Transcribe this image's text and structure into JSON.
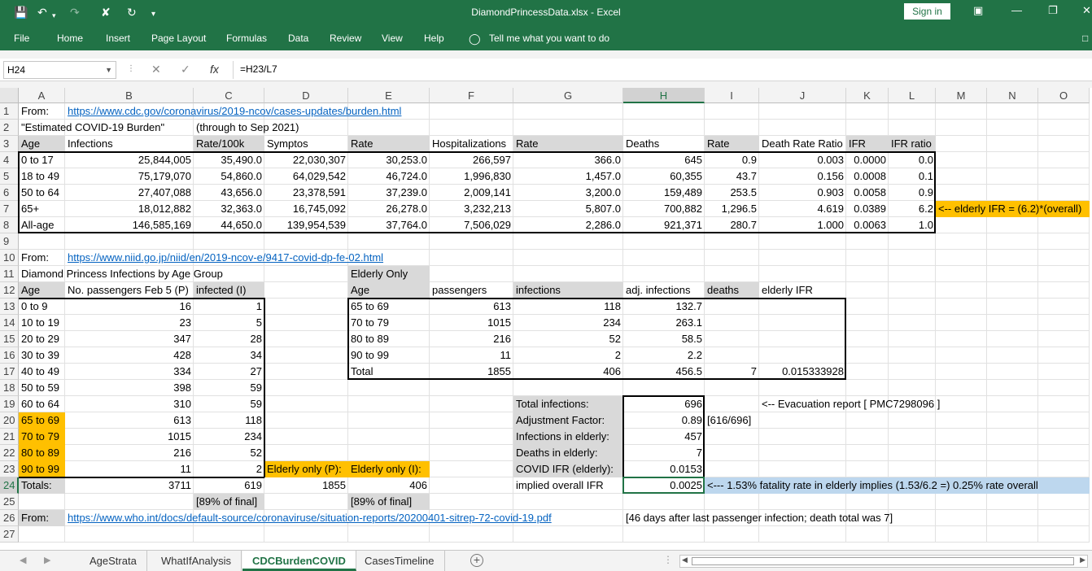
{
  "window": {
    "title": "DiamondPrincessData.xlsx  -  Excel",
    "signin": "Sign in",
    "icons": [
      "save-icon",
      "undo-icon",
      "redo-icon",
      "clear-format-icon",
      "refresh-icon",
      "customize-icon",
      "ribbon-display-icon",
      "minimize-icon",
      "restore-icon",
      "close-icon"
    ]
  },
  "ribbon": {
    "tabs": [
      "File",
      "Home",
      "Insert",
      "Page Layout",
      "Formulas",
      "Data",
      "Review",
      "View",
      "Help"
    ],
    "tell_me": "Tell me what you want to do"
  },
  "formula_bar": {
    "name_box": "H24",
    "fx": "fx",
    "formula": "=H23/L7"
  },
  "columns": [
    "A",
    "B",
    "C",
    "D",
    "E",
    "F",
    "G",
    "H",
    "I",
    "J",
    "K",
    "L",
    "M",
    "N",
    "O"
  ],
  "rows": [
    "1",
    "2",
    "3",
    "4",
    "5",
    "6",
    "7",
    "8",
    "9",
    "10",
    "11",
    "12",
    "13",
    "14",
    "15",
    "16",
    "17",
    "18",
    "19",
    "20",
    "21",
    "22",
    "23",
    "24",
    "25",
    "26",
    "27"
  ],
  "cells": {
    "A1": "From:",
    "B1": "https://www.cdc.gov/coronavirus/2019-ncov/cases-updates/burden.html",
    "A2": "\"Estimated COVID-19 Burden\"",
    "C2": "(through to Sep 2021)",
    "A3": "Age",
    "B3": "Infections",
    "C3": "Rate/100k",
    "D3": "Symptos",
    "E3": "Rate",
    "F3": "Hospitalizations",
    "G3": "Rate",
    "H3": "Deaths",
    "I3": "Rate",
    "J3": "Death Rate Ratio",
    "K3": "IFR",
    "L3": "IFR ratio",
    "A4": "0 to 17",
    "B4": "25,844,005",
    "C4": "35,490.0",
    "D4": "22,030,307",
    "E4": "30,253.0",
    "F4": "266,597",
    "G4": "366.0",
    "H4": "645",
    "I4": "0.9",
    "J4": "0.003",
    "K4": "0.0000",
    "L4": "0.0",
    "A5": "18 to 49",
    "B5": "75,179,070",
    "C5": "54,860.0",
    "D5": "64,029,542",
    "E5": "46,724.0",
    "F5": "1,996,830",
    "G5": "1,457.0",
    "H5": "60,355",
    "I5": "43.7",
    "J5": "0.156",
    "K5": "0.0008",
    "L5": "0.1",
    "A6": "50 to 64",
    "B6": "27,407,088",
    "C6": "43,656.0",
    "D6": "23,378,591",
    "E6": "37,239.0",
    "F6": "2,009,141",
    "G6": "3,200.0",
    "H6": "159,489",
    "I6": "253.5",
    "J6": "0.903",
    "K6": "0.0058",
    "L6": "0.9",
    "A7": "65+",
    "B7": "18,012,882",
    "C7": "32,363.0",
    "D7": "16,745,092",
    "E7": "26,278.0",
    "F7": "3,232,213",
    "G7": "5,807.0",
    "H7": "700,882",
    "I7": "1,296.5",
    "J7": "4.619",
    "K7": "0.0389",
    "L7": "6.2",
    "M7": "<-- elderly IFR = (6.2)*(overall)",
    "A8": "All-age",
    "B8": "146,585,169",
    "C8": "44,650.0",
    "D8": "139,954,539",
    "E8": "37,764.0",
    "F8": "7,506,029",
    "G8": "2,286.0",
    "H8": "921,371",
    "I8": "280.7",
    "J8": "1.000",
    "K8": "0.0063",
    "L8": "1.0",
    "A10": "From:",
    "B10": "https://www.niid.go.jp/niid/en/2019-ncov-e/9417-covid-dp-fe-02.html",
    "A11": "Diamond Princess Infections by Age Group",
    "E11": "Elderly Only",
    "A12": "Age",
    "B12": "No. passengers Feb 5 (P)",
    "C12": "infected (I)",
    "E12": "Age",
    "F12": "passengers",
    "G12": "infections",
    "H12": "adj. infections",
    "I12": "deaths",
    "J12": "elderly IFR",
    "A13": "0 to 9",
    "B13": "16",
    "C13": "1",
    "E13": "65 to 69",
    "F13": "613",
    "G13": "118",
    "H13": "132.7",
    "A14": "10 to 19",
    "B14": "23",
    "C14": "5",
    "E14": "70 to 79",
    "F14": "1015",
    "G14": "234",
    "H14": "263.1",
    "A15": "20 to 29",
    "B15": "347",
    "C15": "28",
    "E15": "80 to 89",
    "F15": "216",
    "G15": "52",
    "H15": "58.5",
    "A16": "30 to 39",
    "B16": "428",
    "C16": "34",
    "E16": "90 to 99",
    "F16": "11",
    "G16": "2",
    "H16": "2.2",
    "A17": "40 to 49",
    "B17": "334",
    "C17": "27",
    "E17": "Total",
    "F17": "1855",
    "G17": "406",
    "H17": "456.5",
    "I17": "7",
    "J17": "0.015333928",
    "A18": "50 to 59",
    "B18": "398",
    "C18": "59",
    "A19": "60 to 64",
    "B19": "310",
    "C19": "59",
    "G19": "Total infections:",
    "H19": "696",
    "J19": "<-- Evacuation report [ PMC7298096 ]",
    "A20": "65 to 69",
    "B20": "613",
    "C20": "118",
    "G20": "Adjustment Factor:",
    "H20": "0.89",
    "I20": "[616/696]",
    "A21": "70 to 79",
    "B21": "1015",
    "C21": "234",
    "G21": "Infections in elderly:",
    "H21": "457",
    "A22": "80 to 89",
    "B22": "216",
    "C22": "52",
    "G22": "Deaths in elderly:",
    "H22": "7",
    "A23": "90 to 99",
    "B23": "11",
    "C23": "2",
    "D23": "Elderly only (P):",
    "E23": "Elderly only (I):",
    "G23": "COVID IFR (elderly):",
    "H23": "0.0153",
    "A24": "Totals:",
    "B24": "3711",
    "C24": "619",
    "D24": "1855",
    "E24": "406",
    "G24": "implied overall IFR",
    "H24": "0.0025",
    "I24": "<--- 1.53% fatality rate in elderly implies (1.53/6.2 =) 0.25% rate overall",
    "C25": "[89% of final]",
    "E25": "[89% of final]",
    "A26": "From:",
    "B26": "https://www.who.int/docs/default-source/coronaviruse/situation-reports/20200401-sitrep-72-covid-19.pdf",
    "H26": "[46 days after last passenger infection; death total was 7]"
  },
  "sheet_tabs": [
    "AgeStrata",
    "WhatIfAnalysis",
    "CDCBurdenCOVID",
    "CasesTimeline"
  ],
  "active_sheet": "CDCBurdenCOVID",
  "colors": {
    "excel_green": "#217346",
    "highlight_orange": "#ffc000",
    "header_gray": "#d9d9d9",
    "note_blue": "#bdd7ee",
    "link_blue": "#0563c1"
  }
}
